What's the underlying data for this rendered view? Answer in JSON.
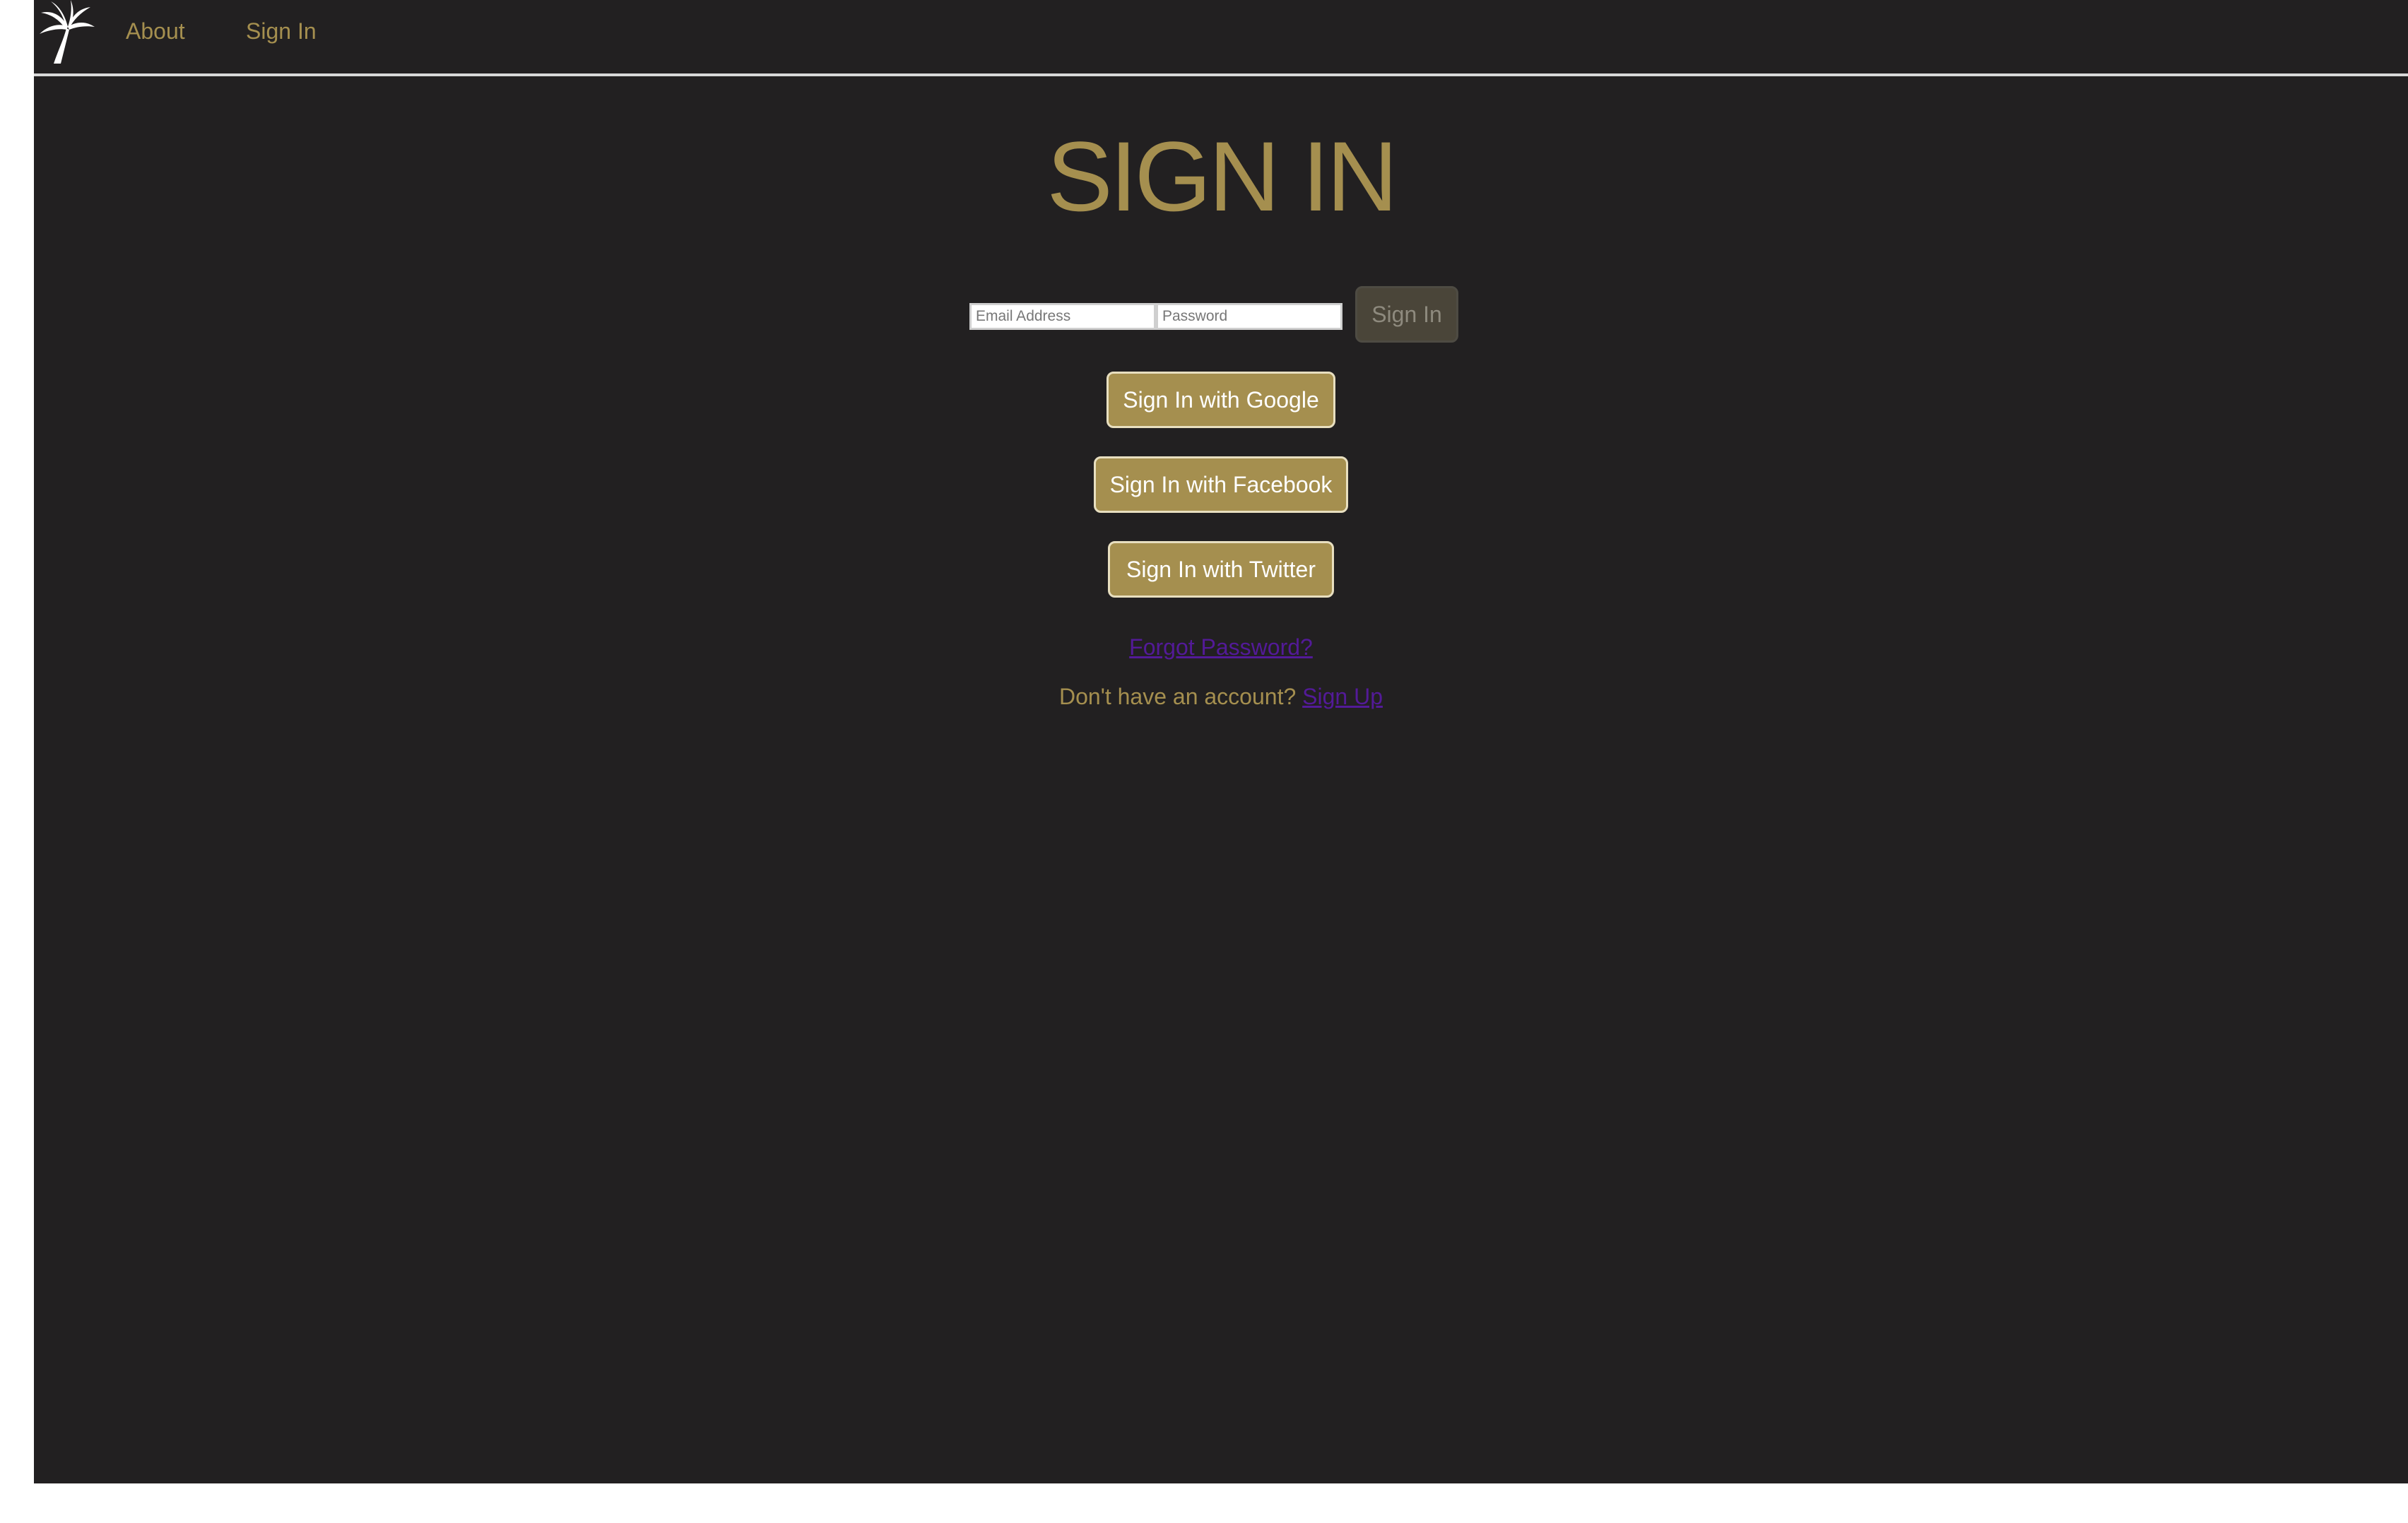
{
  "nav": {
    "logo_icon": "palm-tree-icon",
    "links": [
      "About",
      "Sign In"
    ]
  },
  "page": {
    "title": "SIGN IN"
  },
  "form": {
    "email_placeholder": "Email Address",
    "password_placeholder": "Password",
    "submit_label": "Sign In"
  },
  "social": {
    "google_label": "Sign In with Google",
    "facebook_label": "Sign In with Facebook",
    "twitter_label": "Sign In with Twitter"
  },
  "links": {
    "forgot_password": "Forgot Password?",
    "signup_prompt": "Don't have an account?",
    "signup_link": "Sign Up"
  },
  "colors": {
    "background": "#222021",
    "accent_gold": "#a58f4f",
    "link_purple": "#531a98",
    "disabled_button": "#4a4539"
  }
}
